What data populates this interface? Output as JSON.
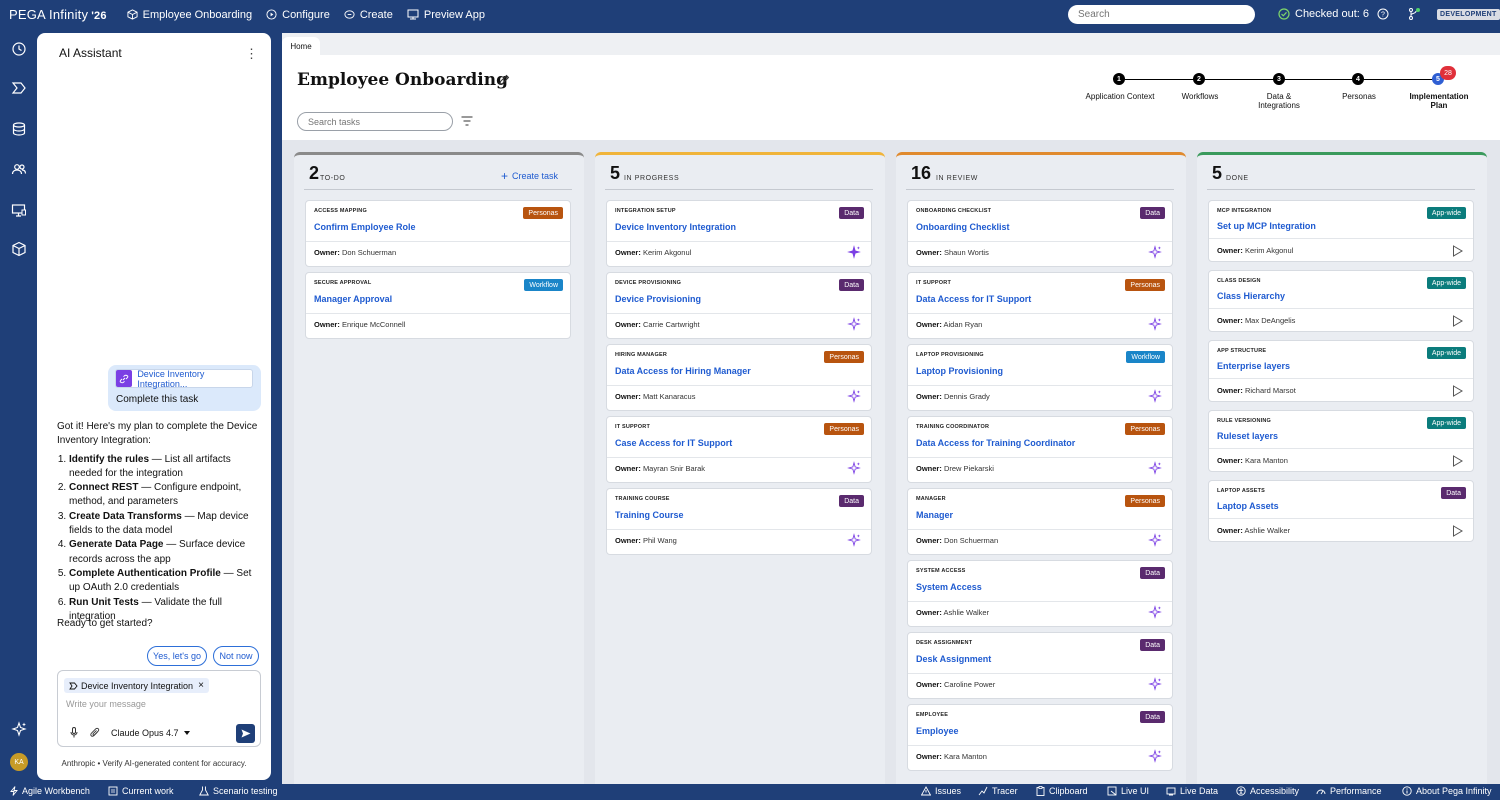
{
  "topbar": {
    "brand": "PEGA Infinity",
    "brand_sup": "'26",
    "nav": [
      {
        "label": "Employee Onboarding",
        "icon": "cube-icon"
      },
      {
        "label": "Configure",
        "icon": "configure-icon"
      },
      {
        "label": "Create",
        "icon": "create-icon"
      },
      {
        "label": "Preview App",
        "icon": "preview-icon"
      }
    ],
    "search_placeholder": "Search",
    "checked_out": "Checked out: 6",
    "env": "DEVELOPMENT"
  },
  "assistant": {
    "title": "AI Assistant",
    "chip_link": "Device Inventory Integration...",
    "chip_text": "Complete this task",
    "intro": "Got it! Here's my plan to complete the Device Inventory Integration:",
    "steps": [
      {
        "bold": "Identify the rules",
        "rest": " — List all artifacts needed for the integration"
      },
      {
        "bold": "Connect REST",
        "rest": " — Configure endpoint, method, and parameters"
      },
      {
        "bold": "Create Data Transforms",
        "rest": " — Map device fields to the data model"
      },
      {
        "bold": "Generate Data Page",
        "rest": " — Surface device records across the app"
      },
      {
        "bold": "Complete Authentication Profile",
        "rest": " — Set up OAuth 2.0 credentials"
      },
      {
        "bold": "Run Unit Tests",
        "rest": " — Validate the full integration"
      }
    ],
    "ready": "Ready to get started?",
    "yes": "Yes, let's go",
    "no": "Not now",
    "compose_tag": "Device Inventory Integration",
    "compose_placeholder": "Write your message",
    "model": "Claude Opus 4.7",
    "footer": "Anthropic • Verify AI-generated content for accuracy.",
    "avatar": "KA"
  },
  "page": {
    "tab": "Home",
    "title": "Employee Onboarding",
    "search_placeholder": "Search tasks",
    "steps": [
      {
        "n": "1",
        "label": "Application Context"
      },
      {
        "n": "2",
        "label": "Workflows"
      },
      {
        "n": "3",
        "label": "Data & Integrations"
      },
      {
        "n": "4",
        "label": "Personas"
      },
      {
        "n": "5",
        "label": "Implementation Plan"
      }
    ],
    "notif": "28"
  },
  "colors": {
    "personas": "#b8540f",
    "workflow": "#1a85c8",
    "data": "#5a2a6e",
    "appwide": "#0b7c7c",
    "todo": "#8a8a8a",
    "progress": "#f0b43a",
    "review": "#e08a2e",
    "done": "#3a9a5c"
  },
  "columns": [
    {
      "count": "2",
      "title": "TO-DO",
      "create": "Create task",
      "cards": [
        {
          "cat": "ACCESS MAPPING",
          "title": "Confirm Employee Role",
          "tag": "Personas",
          "owner": "Don Schuerman",
          "icon": "none"
        },
        {
          "cat": "SECURE APPROVAL",
          "title": "Manager Approval",
          "tag": "Workflow",
          "owner": "Enrique McConnell",
          "icon": "none"
        }
      ]
    },
    {
      "count": "5",
      "title": "IN PROGRESS",
      "cards": [
        {
          "cat": "INTEGRATION SETUP",
          "title": "Device Inventory Integration",
          "tag": "Data",
          "owner": "Kerim Akgonul",
          "icon": "sparkle-filled"
        },
        {
          "cat": "DEVICE PROVISIONING",
          "title": "Device Provisioning",
          "tag": "Data",
          "owner": "Carrie Cartwright",
          "icon": "sparkle"
        },
        {
          "cat": "HIRING MANAGER",
          "title": "Data Access for Hiring Manager",
          "tag": "Personas",
          "owner": "Matt Kanaracus",
          "icon": "sparkle"
        },
        {
          "cat": "IT SUPPORT",
          "title": "Case Access for IT Support",
          "tag": "Personas",
          "owner": "Mayran Snir Barak",
          "icon": "sparkle"
        },
        {
          "cat": "TRAINING COURSE",
          "title": "Training Course",
          "tag": "Data",
          "owner": "Phil Wang",
          "icon": "sparkle"
        }
      ]
    },
    {
      "count": "16",
      "title": "IN REVIEW",
      "cards": [
        {
          "cat": "ONBOARDING CHECKLIST",
          "title": "Onboarding Checklist",
          "tag": "Data",
          "owner": "Shaun Wortis",
          "icon": "sparkle"
        },
        {
          "cat": "IT SUPPORT",
          "title": "Data Access for IT Support",
          "tag": "Personas",
          "owner": "Aidan Ryan",
          "icon": "sparkle"
        },
        {
          "cat": "LAPTOP PROVISIONING",
          "title": "Laptop Provisioning",
          "tag": "Workflow",
          "owner": "Dennis Grady",
          "icon": "sparkle"
        },
        {
          "cat": "TRAINING COORDINATOR",
          "title": "Data Access for Training Coordinator",
          "tag": "Personas",
          "owner": "Drew Piekarski",
          "icon": "sparkle"
        },
        {
          "cat": "MANAGER",
          "title": "Manager",
          "tag": "Personas",
          "owner": "Don Schuerman",
          "icon": "sparkle"
        },
        {
          "cat": "SYSTEM ACCESS",
          "title": "System Access",
          "tag": "Data",
          "owner": "Ashlie Walker",
          "icon": "sparkle"
        },
        {
          "cat": "DESK ASSIGNMENT",
          "title": "Desk Assignment",
          "tag": "Data",
          "owner": "Caroline Power",
          "icon": "sparkle"
        },
        {
          "cat": "EMPLOYEE",
          "title": "Employee",
          "tag": "Data",
          "owner": "Kara Manton",
          "icon": "sparkle"
        }
      ]
    },
    {
      "count": "5",
      "title": "DONE",
      "cards": [
        {
          "cat": "MCP INTEGRATION",
          "title": "Set up MCP Integration",
          "tag": "App-wide",
          "owner": "Kerim Akgonul",
          "icon": "play"
        },
        {
          "cat": "CLASS DESIGN",
          "title": "Class Hierarchy",
          "tag": "App-wide",
          "owner": "Max DeAngelis",
          "icon": "play"
        },
        {
          "cat": "APP STRUCTURE",
          "title": "Enterprise layers",
          "tag": "App-wide",
          "owner": "Richard Marsot",
          "icon": "play"
        },
        {
          "cat": "RULE VERSIONING",
          "title": "Ruleset layers",
          "tag": "App-wide",
          "owner": "Kara Manton",
          "icon": "play"
        },
        {
          "cat": "LAPTOP ASSETS",
          "title": "Laptop Assets",
          "tag": "Data",
          "owner": "Ashlie Walker",
          "icon": "play"
        }
      ]
    }
  ],
  "owner_label": "Owner:",
  "bottombar": {
    "left": [
      "Agile Workbench",
      "Current work",
      "Scenario testing"
    ],
    "right": [
      "Issues",
      "Tracer",
      "Clipboard",
      "Live UI",
      "Live Data",
      "Accessibility",
      "Performance",
      "About Pega Infinity"
    ]
  }
}
